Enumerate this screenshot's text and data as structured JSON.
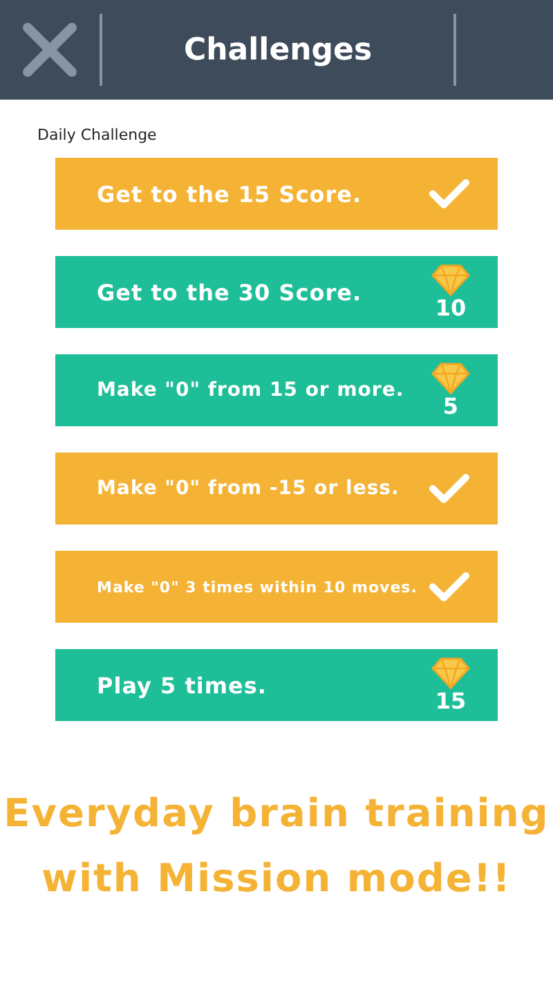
{
  "header": {
    "title": "Challenges"
  },
  "section_label": "Daily Challenge",
  "challenges": [
    {
      "text": "Get to the 15 Score.",
      "completed": true
    },
    {
      "text": "Get to the 30 Score.",
      "completed": false,
      "reward": "10"
    },
    {
      "text": "Make \"0\" from 15 or more.",
      "completed": false,
      "reward": "5"
    },
    {
      "text": "Make \"0\" from -15 or less.",
      "completed": true
    },
    {
      "text": "Make \"0\" 3 times within 10 moves.",
      "completed": true
    },
    {
      "text": "Play 5 times.",
      "completed": false,
      "reward": "15"
    }
  ],
  "promo": [
    "Everyday brain training",
    "with Mission mode!!"
  ]
}
